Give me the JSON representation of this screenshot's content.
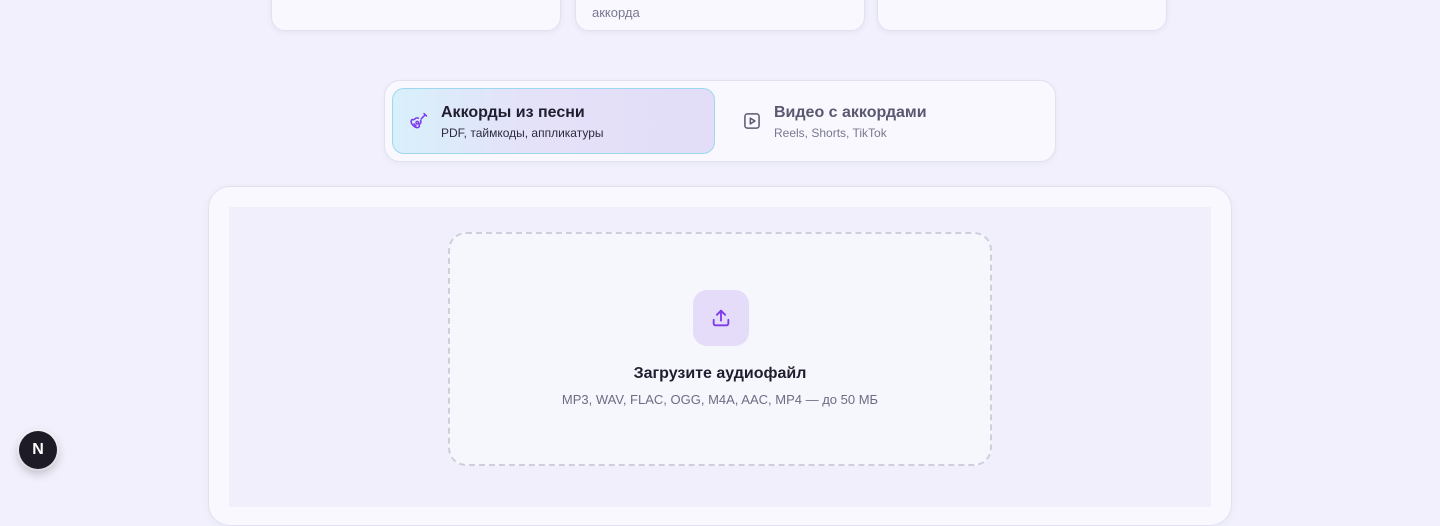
{
  "feature_cards": [
    {
      "text": ""
    },
    {
      "text": "аккорда"
    },
    {
      "text": ""
    }
  ],
  "mode_switcher": {
    "tabs": [
      {
        "title": "Аккорды из песни",
        "subtitle": "PDF, таймкоды, аппликатуры",
        "icon": "guitar-icon",
        "active": true
      },
      {
        "title": "Видео с аккордами",
        "subtitle": "Reels, Shorts, TikTok",
        "icon": "video-play-icon",
        "active": false
      }
    ]
  },
  "upload": {
    "icon": "upload-icon",
    "title": "Загрузите аудиофайл",
    "formats": "MP3, WAV, FLAC, OGG, M4A, AAC, MP4 — до 50 МБ"
  },
  "dev_badge": {
    "label": "N"
  },
  "colors": {
    "background": "#f1f0fc",
    "accent": "#7c3aed",
    "active_tab_border": "#9ed8ee"
  }
}
